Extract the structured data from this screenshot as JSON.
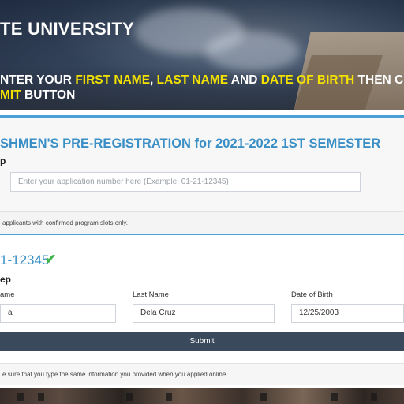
{
  "hero": {
    "university": "TE UNIVERSITY",
    "instruction_parts": [
      "NTER YOUR ",
      "FIRST NAME",
      ", ",
      "LAST NAME",
      " AND ",
      "DATE OF BIRTH",
      " THEN C"
    ],
    "instruction_line2_parts": [
      "MIT",
      " BUTTON"
    ]
  },
  "lookup": {
    "title": "SHMEN'S PRE-REGISTRATION for 2021-2022 1ST SEMESTER",
    "step_label": "p",
    "input_icon": "check-circle-icon",
    "input_placeholder": "Enter your application number here (Example: 01-21-12345)",
    "note": "applicants with confirmed program slots only."
  },
  "verify": {
    "application_number": "1-12345",
    "status_icon": "checkmark-icon",
    "step_label": "ep",
    "fields": {
      "first_name_label": "ame",
      "first_name_value": "a",
      "last_name_label": "Last Name",
      "last_name_value": "Dela Cruz",
      "dob_label": "Date of Birth",
      "dob_value": "12/25/2003"
    },
    "submit_label": "Submit",
    "note": "e sure that you type the same information you provided when you applied online."
  },
  "colors": {
    "accent": "#3a8fc6",
    "highlight": "#f3e100",
    "button": "#3a4a5c",
    "success": "#3bb54a"
  }
}
